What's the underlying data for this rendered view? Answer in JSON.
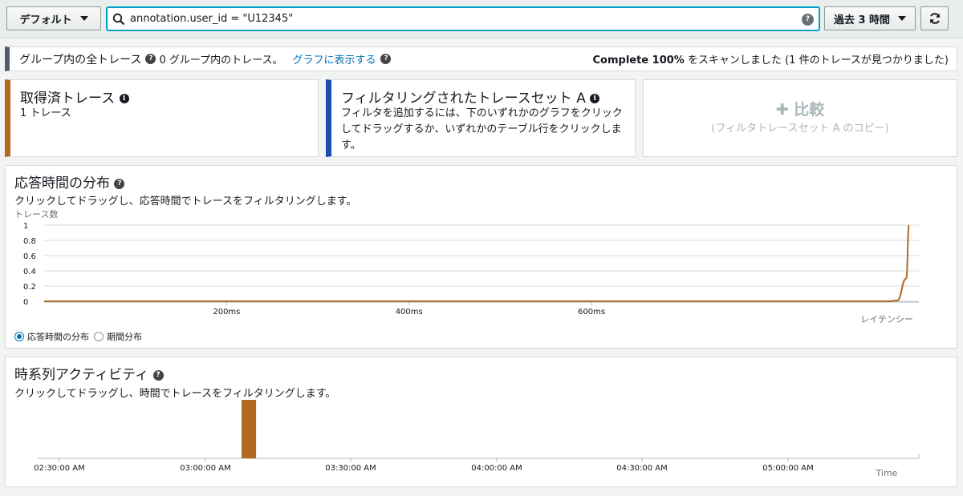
{
  "toolbar": {
    "group_select": "デフォルト",
    "search_value": "annotation.user_id = \"U12345\"",
    "time_range": "過去 3 時間",
    "refresh_icon": "refresh-icon"
  },
  "groupbar": {
    "title": "グループ内の全トレース",
    "count_text": "0 グループ内のトレース。",
    "graph_link": "グラフに表示する",
    "scan_bold": "Complete 100%",
    "scan_text": "をスキャンしました (1 件のトレースが見つかりました)"
  },
  "cards": {
    "retrieved": {
      "title": "取得済トレース",
      "sub": "1 トレース"
    },
    "filtered": {
      "title": "フィルタリングされたトレースセット A",
      "sub": "フィルタを追加するには、下のいずれかのグラフをクリックしてドラッグするか、いずれかのテーブル行をクリックします。"
    },
    "compare": {
      "title": "比較",
      "sub": "(フィルタトレースセット A のコピー)"
    }
  },
  "response": {
    "title": "応答時間の分布",
    "desc": "クリックしてドラッグし、応答時間でトレースをフィルタリングします。",
    "y_label": "トレース数",
    "radio_1": "応答時間の分布",
    "radio_2": "期間分布"
  },
  "timeseries": {
    "title": "時系列アクティビティ",
    "desc": "クリックしてドラッグし、時間でトレースをフィルタリングします。"
  },
  "chart_data": [
    {
      "type": "line",
      "title": "応答時間の分布",
      "ylabel": "トレース数",
      "xlabel": "レイテンシー",
      "y_ticks": [
        "0",
        "0.2",
        "0.4",
        "0.6",
        "0.8",
        "1"
      ],
      "x_ticks": [
        "200ms",
        "400ms",
        "600ms"
      ],
      "ylim": [
        0,
        1
      ],
      "xlim_ms": [
        0,
        950
      ],
      "color": "#b06a22",
      "series": [
        {
          "x": [
            0,
            900,
            925,
            935,
            945,
            948
          ],
          "y": [
            0,
            0,
            0,
            0.01,
            0.3,
            1
          ]
        }
      ]
    },
    {
      "type": "bar",
      "title": "時系列アクティビティ",
      "xlabel": "Time",
      "x_ticks": [
        "02:30:00 AM",
        "03:00:00 AM",
        "03:30:00 AM",
        "04:00:00 AM",
        "04:30:00 AM",
        "05:00:00 AM"
      ],
      "color": "#b06a22",
      "bars": [
        {
          "time": "03:09:00 AM",
          "count": 1
        }
      ]
    }
  ]
}
